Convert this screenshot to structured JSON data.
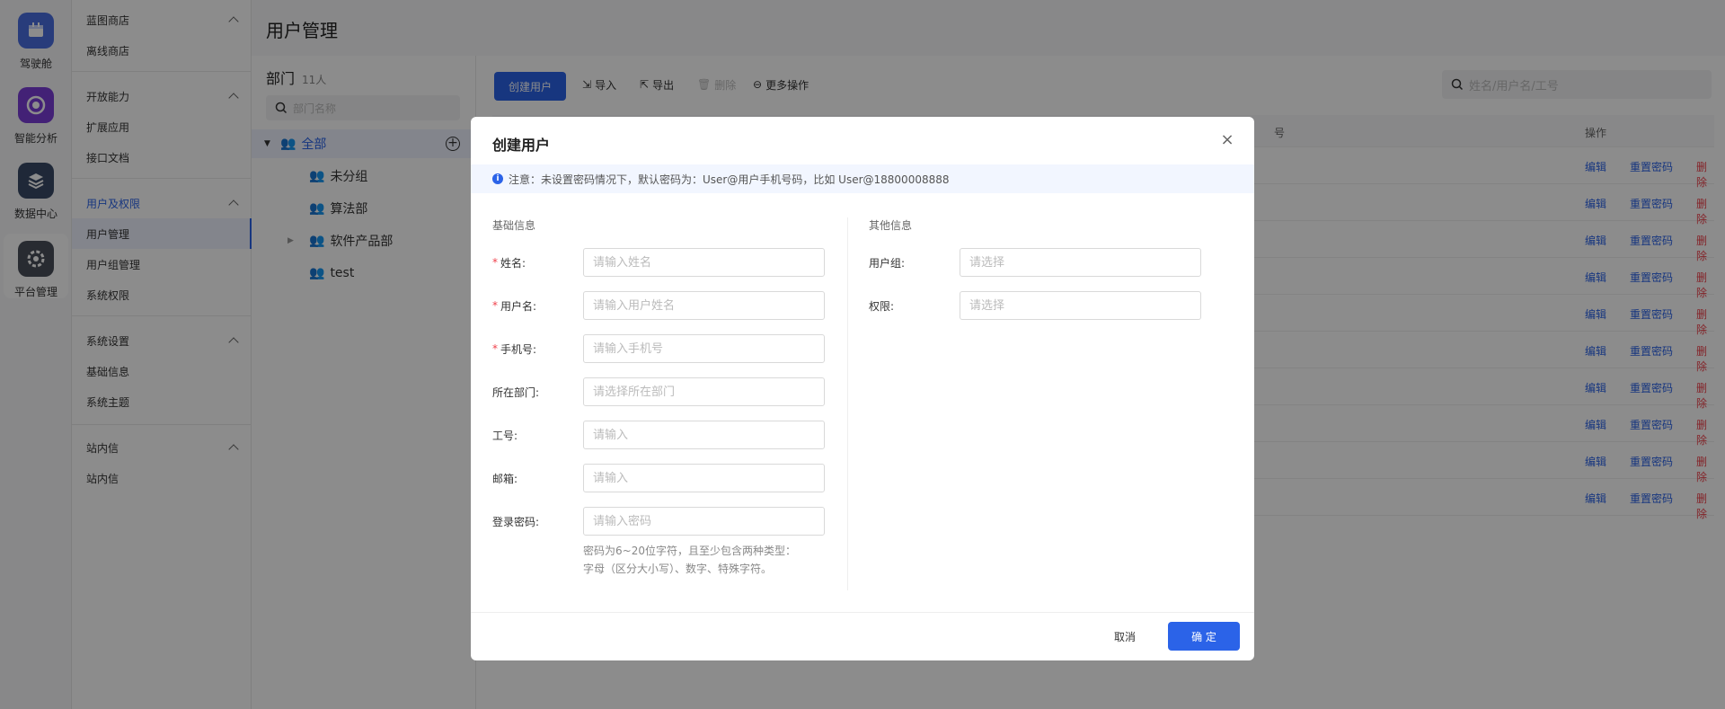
{
  "rail": [
    {
      "label": "驾驶舱",
      "icon": "calendar-icon",
      "color": "#4a6ee0"
    },
    {
      "label": "智能分析",
      "icon": "analysis-icon",
      "color": "#7a3dd8"
    },
    {
      "label": "数据中心",
      "icon": "layers-icon",
      "color": "#3a4a66"
    },
    {
      "label": "平台管理",
      "icon": "gear-icon",
      "color": "#4a4f5a"
    }
  ],
  "menu": {
    "groups": [
      {
        "title": "蓝图商店",
        "items": [
          "离线商店"
        ]
      },
      {
        "title": "开放能力",
        "items": [
          "扩展应用",
          "接口文档"
        ]
      },
      {
        "title": "用户及权限",
        "items": [
          "用户管理",
          "用户组管理",
          "系统权限"
        ]
      },
      {
        "title": "系统设置",
        "items": [
          "基础信息",
          "系统主题"
        ]
      },
      {
        "title": "站内信",
        "items": [
          "站内信"
        ]
      }
    ]
  },
  "page": {
    "title": "用户管理"
  },
  "dept": {
    "title": "部门",
    "count": "11人",
    "search_placeholder": "部门名称",
    "tree": [
      "全部",
      "未分组",
      "算法部",
      "软件产品部",
      "test"
    ]
  },
  "toolbar": {
    "create": "创建用户",
    "import": "导入",
    "export": "导出",
    "delete": "删除",
    "more": "更多操作",
    "search_placeholder": "姓名/用户名/工号"
  },
  "table": {
    "col_fragment": "号",
    "col_ops": "操作",
    "row_count": 10,
    "edit": "编辑",
    "reset": "重置密码",
    "remove": "删除"
  },
  "modal": {
    "title": "创建用户",
    "notice": "注意：未设置密码情况下，默认密码为：User@用户手机号码，比如 User@18800008888",
    "basic_title": "基础信息",
    "other_title": "其他信息",
    "fields": {
      "name": {
        "label": "姓名:",
        "placeholder": "请输入姓名"
      },
      "username": {
        "label": "用户名:",
        "placeholder": "请输入用户姓名"
      },
      "phone": {
        "label": "手机号:",
        "placeholder": "请输入手机号"
      },
      "dept": {
        "label": "所在部门:",
        "placeholder": "请选择所在部门"
      },
      "jobno": {
        "label": "工号:",
        "placeholder": "请输入"
      },
      "email": {
        "label": "邮箱:",
        "placeholder": "请输入"
      },
      "password": {
        "label": "登录密码:",
        "placeholder": "请输入密码"
      },
      "group": {
        "label": "用户组:",
        "placeholder": "请选择"
      },
      "perm": {
        "label": "权限:",
        "placeholder": "请选择"
      }
    },
    "hint_line1": "密码为6~20位字符，且至少包含两种类型：",
    "hint_line2": "字母（区分大小写）、数字、特殊字符。",
    "cancel": "取消",
    "ok": "确 定"
  },
  "colors": {
    "accent": "#2b63e8",
    "danger": "#f0414b"
  }
}
